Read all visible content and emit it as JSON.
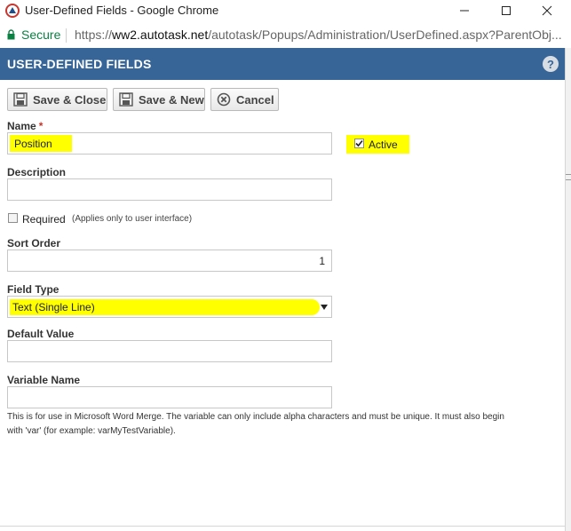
{
  "window": {
    "title": "User-Defined Fields - Google Chrome",
    "secure_label": "Secure",
    "url_scheme": "https://",
    "url_domain": "ww2.autotask.net",
    "url_path": "/autotask/Popups/Administration/UserDefined.aspx?ParentObj..."
  },
  "header": {
    "title": "USER-DEFINED FIELDS",
    "help_glyph": "?"
  },
  "toolbar": {
    "save_close_label": "Save & Close",
    "save_new_label": "Save & New",
    "cancel_label": "Cancel"
  },
  "form": {
    "name_label": "Name",
    "required_marker": "*",
    "name_value": "Position",
    "active_label": "Active",
    "active_checked": true,
    "description_label": "Description",
    "description_value": "",
    "required_label": "Required",
    "required_note": "(Applies only to user interface)",
    "required_checked": false,
    "sort_order_label": "Sort Order",
    "sort_order_value": "1",
    "field_type_label": "Field Type",
    "field_type_value": "Text (Single Line)",
    "default_value_label": "Default Value",
    "default_value": "",
    "variable_name_label": "Variable Name",
    "variable_name_value": "",
    "variable_note": "This is for use in Microsoft Word Merge. The variable can only include alpha characters and must be unique. It must also begin with 'var' (for example: varMyTestVariable)."
  },
  "icons": {
    "app": "autotask-app-icon",
    "lock": "lock-icon",
    "save": "floppy-disk-icon",
    "cancel": "cancel-circle-icon",
    "help": "help-icon",
    "dropdown": "caret-down-icon"
  },
  "colors": {
    "header_bg": "#376597",
    "highlight": "#ffff00",
    "secure_green": "#0b8043",
    "required_red": "#c0392b"
  }
}
